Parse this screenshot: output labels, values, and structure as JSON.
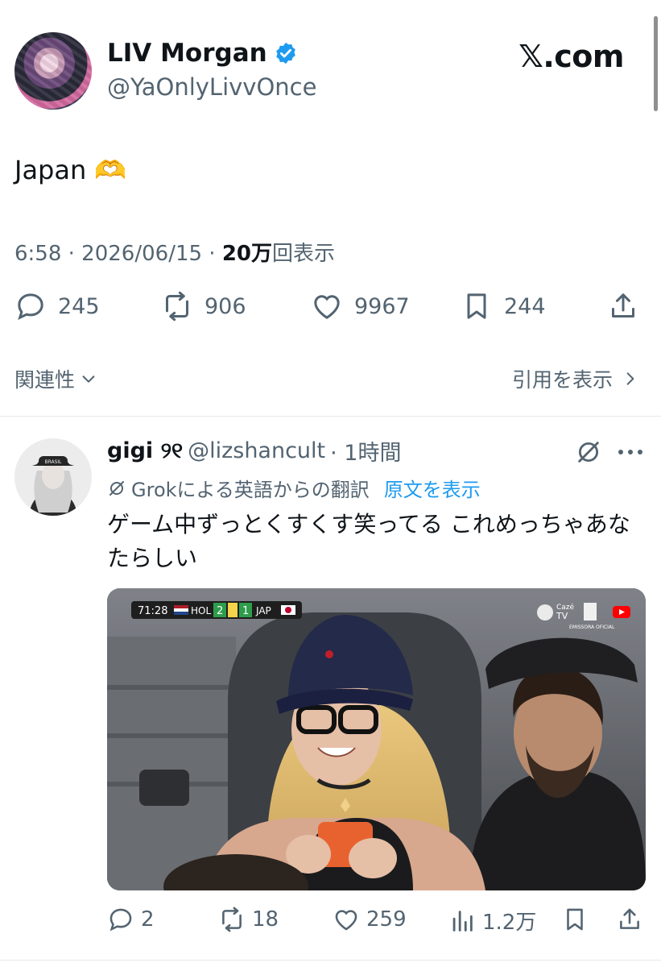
{
  "tweet": {
    "author_name": "LIV Morgan",
    "author_handle": "@YaOnlyLivvOnce",
    "site_logo": "𝕏.com",
    "text": "Japan 🫶",
    "timestamp": "6:58 · 2026/06/15 · ",
    "views_count": "20万",
    "views_label": "回表示",
    "stats": {
      "replies": "245",
      "reposts": "906",
      "likes": "9967",
      "bookmarks": "244"
    },
    "related_label": "関連性",
    "quotes_label": "引用を表示"
  },
  "reply": {
    "name": "gigi ୨୧",
    "handle": "@lizshancult",
    "time": "· 1時間",
    "translation_note": "Grokによる英語からの翻訳",
    "show_original": "原文を表示",
    "text": "ゲーム中ずっとくすくす笑ってる これめっちゃあなたらしい",
    "stats": {
      "replies": "2",
      "reposts": "18",
      "likes": "259",
      "views": "1.2万"
    },
    "media": {
      "score_time": "71:28",
      "home_team": "HOL",
      "home_score": "2",
      "away_score": "1",
      "away_team": "JAP",
      "broadcaster_top": "Cazé",
      "broadcaster_bottom": "TV",
      "broadcaster_note": "EMISSORA OFICIAL"
    }
  },
  "colors": {
    "text": "#0f1419",
    "muted": "#536471",
    "accent": "#1d9bf0"
  },
  "icons": [
    "verified-icon",
    "reply-icon",
    "repost-icon",
    "like-icon",
    "bookmark-icon",
    "share-icon",
    "chevron-down-icon",
    "chevron-right-icon",
    "grok-icon",
    "more-icon",
    "views-icon"
  ]
}
